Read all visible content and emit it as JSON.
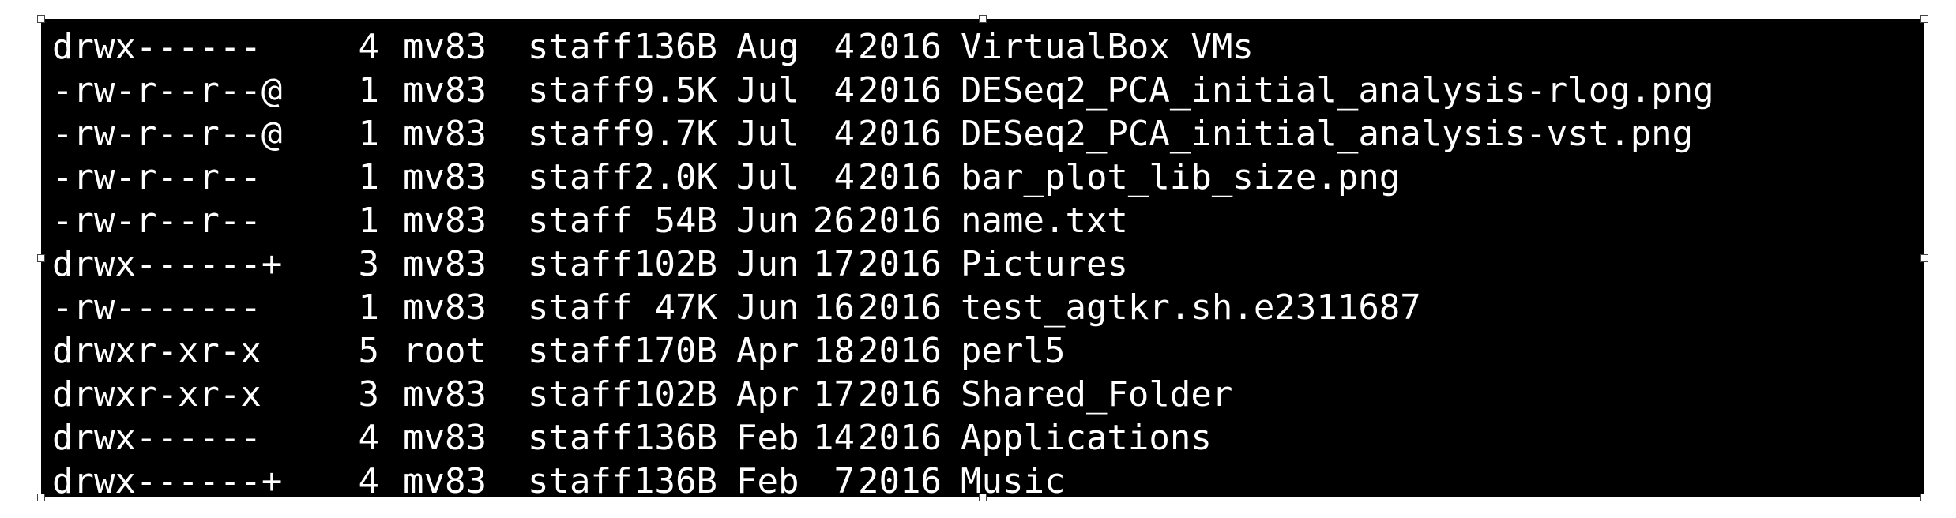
{
  "colors": {
    "background": "#000000",
    "text": "#ffffff",
    "page": "#ffffff"
  },
  "listing": {
    "rows": [
      {
        "perms": "drwx------",
        "links": "4",
        "owner": "mv83",
        "group": "staff",
        "size": "136B",
        "month": "Aug",
        "day": "4",
        "year": "2016",
        "name": "VirtualBox VMs"
      },
      {
        "perms": "-rw-r--r--@",
        "links": "1",
        "owner": "mv83",
        "group": "staff",
        "size": "9.5K",
        "month": "Jul",
        "day": "4",
        "year": "2016",
        "name": "DESeq2_PCA_initial_analysis-rlog.png"
      },
      {
        "perms": "-rw-r--r--@",
        "links": "1",
        "owner": "mv83",
        "group": "staff",
        "size": "9.7K",
        "month": "Jul",
        "day": "4",
        "year": "2016",
        "name": "DESeq2_PCA_initial_analysis-vst.png"
      },
      {
        "perms": "-rw-r--r--",
        "links": "1",
        "owner": "mv83",
        "group": "staff",
        "size": "2.0K",
        "month": "Jul",
        "day": "4",
        "year": "2016",
        "name": "bar_plot_lib_size.png"
      },
      {
        "perms": "-rw-r--r--",
        "links": "1",
        "owner": "mv83",
        "group": "staff",
        "size": "54B",
        "month": "Jun",
        "day": "26",
        "year": "2016",
        "name": "name.txt"
      },
      {
        "perms": "drwx------+",
        "links": "3",
        "owner": "mv83",
        "group": "staff",
        "size": "102B",
        "month": "Jun",
        "day": "17",
        "year": "2016",
        "name": "Pictures"
      },
      {
        "perms": "-rw-------",
        "links": "1",
        "owner": "mv83",
        "group": "staff",
        "size": "47K",
        "month": "Jun",
        "day": "16",
        "year": "2016",
        "name": "test_agtkr.sh.e2311687"
      },
      {
        "perms": "drwxr-xr-x",
        "links": "5",
        "owner": "root",
        "group": "staff",
        "size": "170B",
        "month": "Apr",
        "day": "18",
        "year": "2016",
        "name": "perl5"
      },
      {
        "perms": "drwxr-xr-x",
        "links": "3",
        "owner": "mv83",
        "group": "staff",
        "size": "102B",
        "month": "Apr",
        "day": "17",
        "year": "2016",
        "name": "Shared_Folder"
      },
      {
        "perms": "drwx------",
        "links": "4",
        "owner": "mv83",
        "group": "staff",
        "size": "136B",
        "month": "Feb",
        "day": "14",
        "year": "2016",
        "name": "Applications"
      },
      {
        "perms": "drwx------+",
        "links": "4",
        "owner": "mv83",
        "group": "staff",
        "size": "136B",
        "month": "Feb",
        "day": "7",
        "year": "2016",
        "name": "Music"
      }
    ]
  }
}
